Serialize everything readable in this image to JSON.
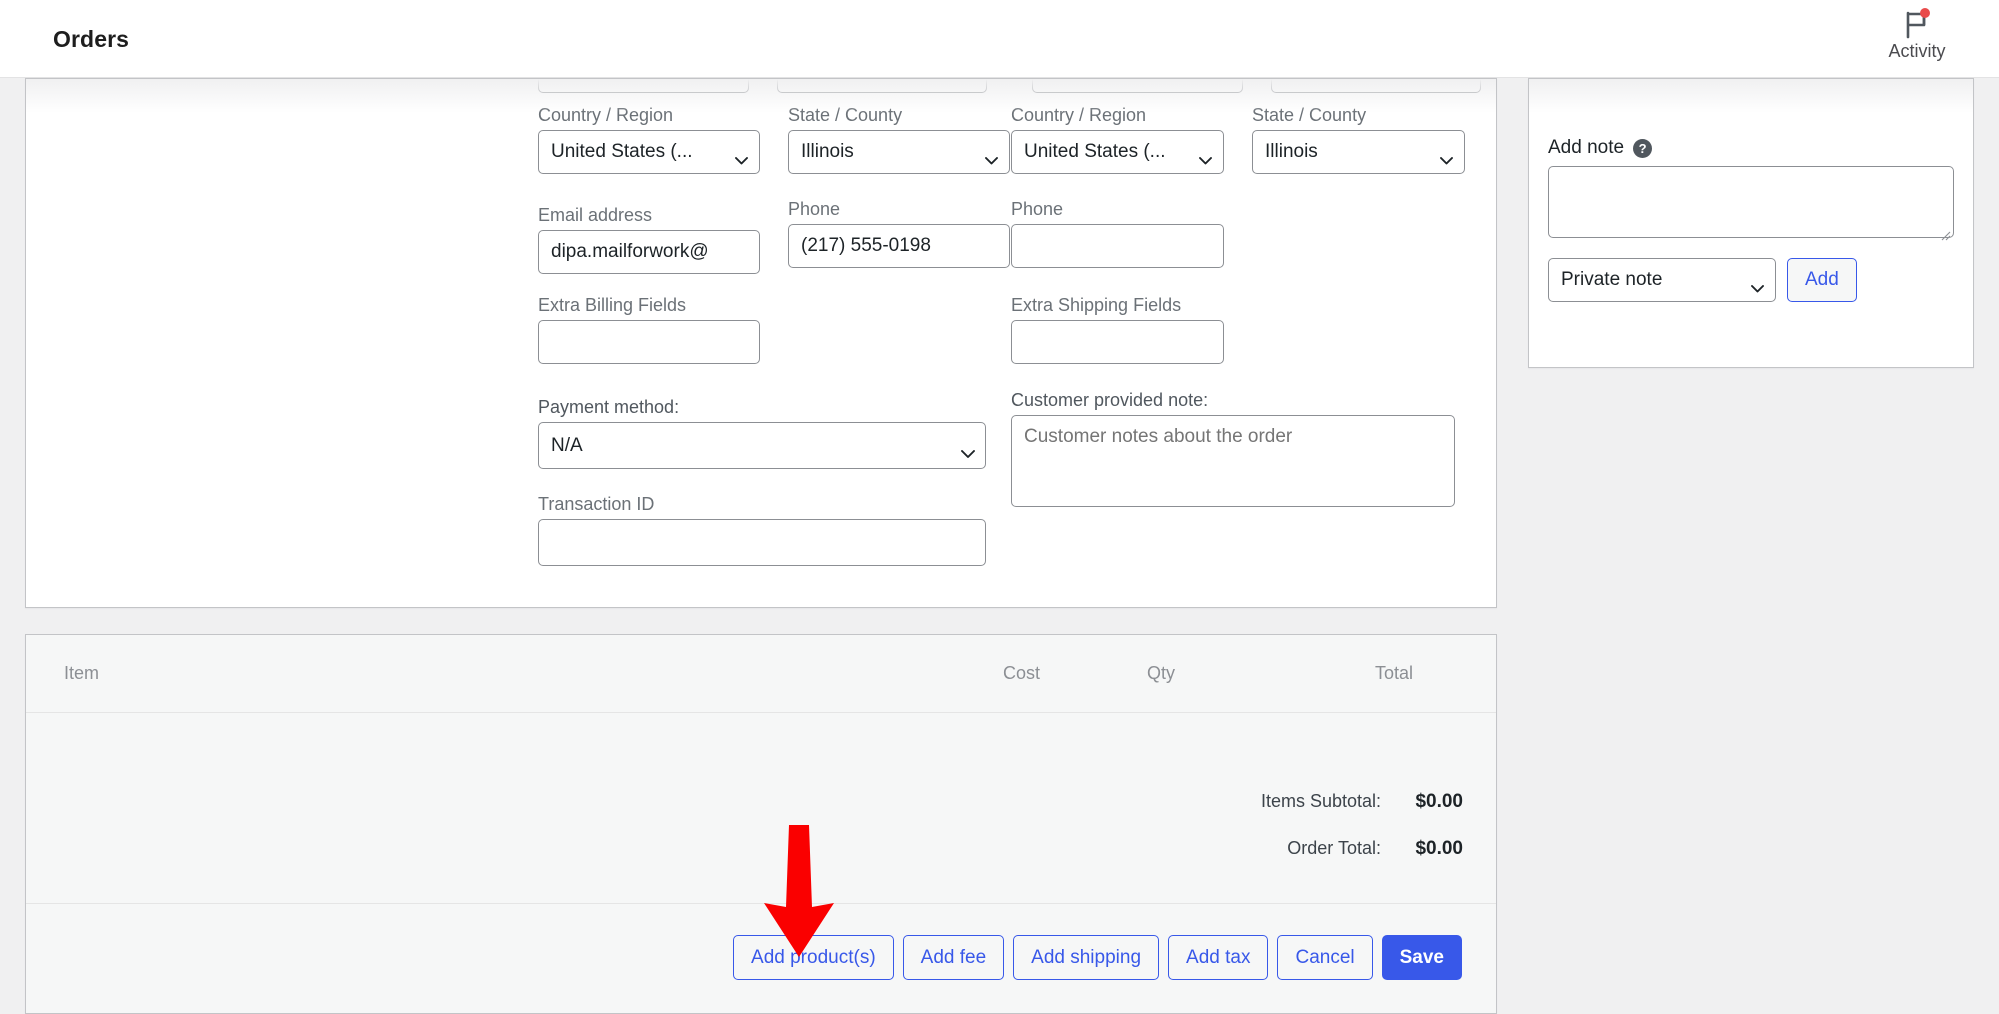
{
  "topbar": {
    "title": "Orders",
    "activity_label": "Activity",
    "activity_icon": "flag-icon",
    "has_notification_dot": true,
    "notification_color": "#e94b4b"
  },
  "colors": {
    "accent_blue": "#3858e9",
    "panel_bg": "#f6f7f7",
    "page_bg": "#f0f0f1",
    "border": "#c3c4c7",
    "annotation_red": "#fa0000"
  },
  "order_data": {
    "billing": {
      "country_label": "Country / Region",
      "country_value": "United States (...",
      "state_label": "State / County",
      "state_value": "Illinois",
      "email_label": "Email address",
      "email_value": "dipa.mailforwork@",
      "phone_label": "Phone",
      "phone_value": "(217) 555-0198",
      "extra_label": "Extra Billing Fields",
      "extra_value": "",
      "payment_label": "Payment method:",
      "payment_value": "N/A",
      "transaction_label": "Transaction ID",
      "transaction_value": ""
    },
    "shipping": {
      "country_label": "Country / Region",
      "country_value": "United States (...",
      "state_label": "State / County",
      "state_value": "Illinois",
      "phone_label": "Phone",
      "phone_value": "",
      "extra_label": "Extra Shipping Fields",
      "extra_value": "",
      "customer_note_label": "Customer provided note:",
      "customer_note_placeholder": "Customer notes about the order",
      "customer_note_value": ""
    }
  },
  "items": {
    "columns": {
      "item": "Item",
      "cost": "Cost",
      "qty": "Qty",
      "total": "Total"
    },
    "rows": [],
    "totals": [
      {
        "label": "Items Subtotal:",
        "value": "$0.00"
      },
      {
        "label": "Order Total:",
        "value": "$0.00"
      }
    ],
    "buttons": [
      {
        "label": "Add product(s)",
        "style": "secondary",
        "name": "add-products-button"
      },
      {
        "label": "Add fee",
        "style": "secondary",
        "name": "add-fee-button"
      },
      {
        "label": "Add shipping",
        "style": "secondary",
        "name": "add-shipping-button"
      },
      {
        "label": "Add tax",
        "style": "secondary",
        "name": "add-tax-button"
      },
      {
        "label": "Cancel",
        "style": "secondary",
        "name": "cancel-button"
      },
      {
        "label": "Save",
        "style": "primary",
        "name": "save-button"
      }
    ]
  },
  "notes": {
    "add_note_label": "Add note",
    "help_icon": "question-mark-icon",
    "note_value": "",
    "note_type_value": "Private note",
    "add_button_label": "Add"
  },
  "annotation": {
    "type": "arrow",
    "direction": "down",
    "points_at": "Add product(s)",
    "color": "#fa0000"
  }
}
